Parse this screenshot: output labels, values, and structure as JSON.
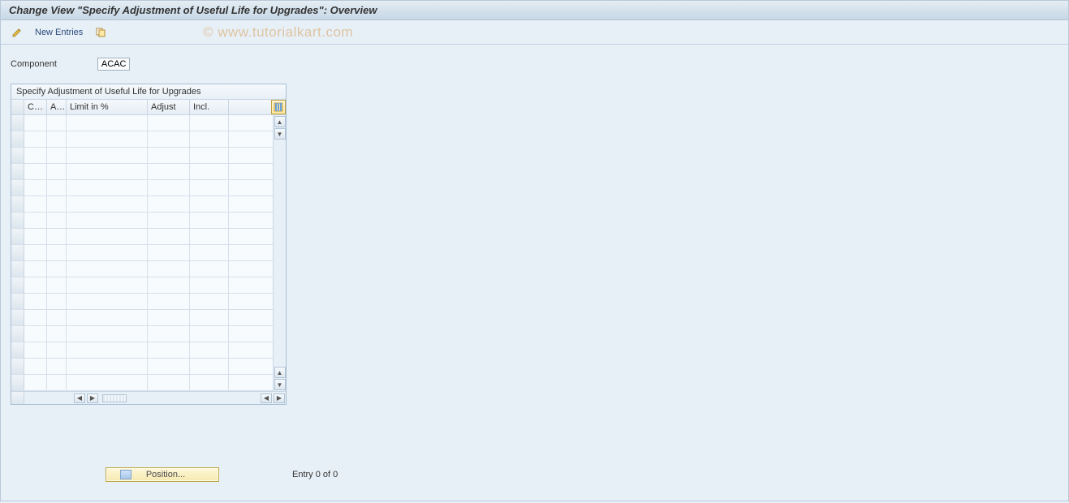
{
  "title": "Change View \"Specify Adjustment of Useful Life for Upgrades\": Overview",
  "toolbar": {
    "new_entries_label": "New Entries"
  },
  "watermark": "© www.tutorialkart.com",
  "field": {
    "component_label": "Component",
    "component_value": "ACAC"
  },
  "table": {
    "title": "Specify Adjustment of Useful Life for Upgrades",
    "columns": {
      "co": "Co...",
      "ac": "Ac...",
      "limit": "Limit in %",
      "adjust": "Adjust",
      "incl": "Incl."
    },
    "row_count": 17
  },
  "footer": {
    "position_label": "Position...",
    "status": "Entry 0 of 0"
  }
}
